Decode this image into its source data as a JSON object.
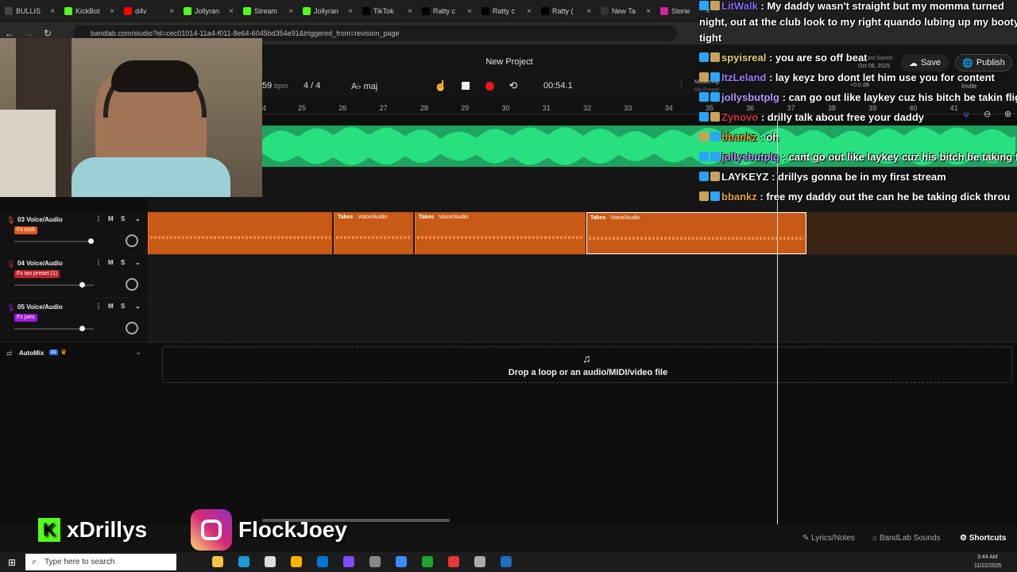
{
  "browser": {
    "tabs": [
      {
        "label": "BULLIS",
        "color": "#444"
      },
      {
        "label": "KickBot",
        "color": "#53fc18"
      },
      {
        "label": "d4v",
        "color": "#ff0000"
      },
      {
        "label": "Jollyran",
        "color": "#53fc18"
      },
      {
        "label": "Stream",
        "color": "#53fc18"
      },
      {
        "label": "Jollyran",
        "color": "#53fc18"
      },
      {
        "label": "TikTok",
        "color": "#000"
      },
      {
        "label": "Ratty c",
        "color": "#000"
      },
      {
        "label": "Ratty c",
        "color": "#000"
      },
      {
        "label": "Ratty (",
        "color": "#000"
      },
      {
        "label": "New Ta",
        "color": "#333"
      },
      {
        "label": "Storie",
        "color": "#d6249f"
      }
    ],
    "url": "bandlab.com/studio?id=cec01014-11a4-f011-8e64-6045bd354e91&triggered_from=revision_page"
  },
  "header": {
    "project_title": "New Project",
    "bpm_value": "59",
    "bpm_unit": "bpm",
    "time_sig": "4 / 4",
    "key": "A♭ maj",
    "time": "00:54.1",
    "mastering": "Mastering",
    "no_preset": "No Preset",
    "last_saved_label": "Last Saved",
    "last_saved_date": "Oct 08, 2025",
    "db": "+0.0 dB",
    "invite": "Invite",
    "save": "Save",
    "publish": "Publish"
  },
  "ruler": {
    "numbers": [
      "4",
      "25",
      "26",
      "27",
      "28",
      "29",
      "30",
      "31",
      "32",
      "33",
      "34",
      "35",
      "36",
      "37",
      "38",
      "39",
      "40",
      "41"
    ]
  },
  "tracks": [
    {
      "number_name": "03 Voice/Audio",
      "fx": "Fx took",
      "fx_color": "#e05a1a",
      "icon_color": "#e05a1a",
      "level": 0.97
    },
    {
      "number_name": "04 Voice/Audio",
      "fx": "Fx ian preset (1)",
      "fx_color": "#c0232b",
      "icon_color": "#c0232b",
      "level": 0.86
    },
    {
      "number_name": "05 Voice/Audio",
      "fx": "Fx joes",
      "fx_color": "#9b19d8",
      "icon_color": "#9b19d8",
      "level": 0.86
    }
  ],
  "track_buttons": {
    "mute": "M",
    "solo": "S"
  },
  "clips": [
    {
      "takes": "Takes",
      "label": "Voice/Audio"
    },
    {
      "takes": "Takes",
      "label": "Voice/Audio"
    },
    {
      "takes": "Takes",
      "label": "Voice/Audio"
    }
  ],
  "automix": {
    "label": "AutoMix",
    "badge": "AI"
  },
  "drop_zone": {
    "text": "Drop a loop or an audio/MIDI/video file"
  },
  "bottom": {
    "lyrics": "Lyrics/Notes",
    "sounds": "BandLab Sounds",
    "shortcuts": "Shortcuts"
  },
  "chat": [
    {
      "user": "LitWalk",
      "user_color": "#8c6cff",
      "text": "My daddy wasn't straight but my momma turned"
    },
    {
      "user": "",
      "user_color": "#fff",
      "text": "night, out at the club look to my right quando lubing up my booty n"
    },
    {
      "user": "",
      "user_color": "#fff",
      "text": "tight"
    },
    {
      "user": "spyisreal",
      "user_color": "#e8cf7a",
      "text": "you are so off beat"
    },
    {
      "user": "ItzLeland",
      "user_color": "#a07cff",
      "text": "lay keyz bro dont let him use you for content"
    },
    {
      "user": "jollysbutplg",
      "user_color": "#b89cff",
      "text": "can go out like laykey cuz his bitch be takin flight"
    },
    {
      "user": "Zynovo",
      "user_color": "#d23a3a",
      "text": "drilly talk about free your daddy"
    },
    {
      "user": "bbankz",
      "user_color": "#e8a33a",
      "text": "oh"
    },
    {
      "user": "jollysbutplg",
      "user_color": "#b89cff",
      "text": "cant go out like laykey cuz his bitch be taking flig"
    },
    {
      "user": "LAYKEYZ",
      "user_color": "#f0f0f0",
      "text": "drillys gonna be in my first stream"
    },
    {
      "user": "bbankz",
      "user_color": "#e8a33a",
      "text": "free my daddy out the can he be taking dick throu"
    }
  ],
  "socials": {
    "kick": "xDrillys",
    "instagram": "FlockJoey"
  },
  "taskbar": {
    "search_placeholder": "Type here to search",
    "time": "3:44 AM",
    "date": "11/22/2025"
  }
}
